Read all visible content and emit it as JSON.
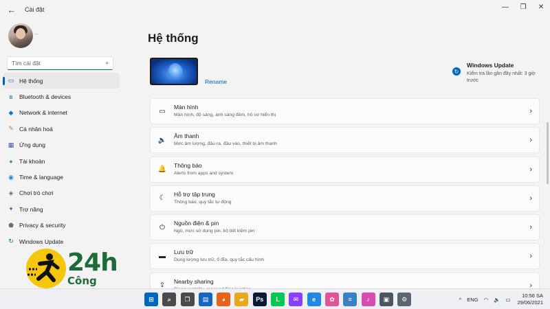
{
  "window": {
    "title": "Cài đặt",
    "controls": {
      "minimize": "—",
      "maximize": "❐",
      "close": "✕"
    }
  },
  "search": {
    "placeholder": "Tìm cài đặt"
  },
  "sidebar": {
    "items": [
      {
        "label": "Hệ thống",
        "icon": "system-icon",
        "glyph": "▭",
        "color": "#0067c0",
        "active": true
      },
      {
        "label": "Bluetooth & devices",
        "icon": "bluetooth-icon",
        "glyph": "ʙ",
        "color": "#0067c0"
      },
      {
        "label": "Network & internet",
        "icon": "network-icon",
        "glyph": "◆",
        "color": "#0078d4"
      },
      {
        "label": "Cá nhân hoá",
        "icon": "brush-icon",
        "glyph": "✎",
        "color": "#e07b2c"
      },
      {
        "label": "Ứng dụng",
        "icon": "apps-icon",
        "glyph": "▦",
        "color": "#3c5a99"
      },
      {
        "label": "Tài khoản",
        "icon": "account-icon",
        "glyph": "●",
        "color": "#2aa876"
      },
      {
        "label": "Time & language",
        "icon": "globe-icon",
        "glyph": "◉",
        "color": "#1a88d8"
      },
      {
        "label": "Chơi trò chơi",
        "icon": "gaming-icon",
        "glyph": "◈",
        "color": "#6b6b6b"
      },
      {
        "label": "Trợ năng",
        "icon": "accessibility-icon",
        "glyph": "✦",
        "color": "#1a6fd1"
      },
      {
        "label": "Privacy & security",
        "icon": "shield-icon",
        "glyph": "⬟",
        "color": "#6e6e6e"
      },
      {
        "label": "Windows Update",
        "icon": "update-icon",
        "glyph": "↻",
        "color": "#0067c0"
      }
    ]
  },
  "main": {
    "page_title": "Hệ thống",
    "rename": "Rename",
    "windows_update": {
      "title": "Windows Update",
      "subtitle": "Kiểm tra lần gần đây nhất: 3 giờ trước"
    },
    "cards": [
      {
        "title": "Màn hình",
        "desc": "Màn hình, độ sáng, ánh sáng đêm, hồ sơ hiển thị",
        "icon": "display-icon",
        "glyph": "▭"
      },
      {
        "title": "Âm thanh",
        "desc": "Mức âm lượng, đầu ra, đầu vào, thiết bị âm thanh",
        "icon": "speaker-icon",
        "glyph": "🔈"
      },
      {
        "title": "Thông báo",
        "desc": "Alerts from apps and system",
        "icon": "bell-icon",
        "glyph": "🔔"
      },
      {
        "title": "Hỗ trợ tập trung",
        "desc": "Thông báo, quy tắc tự động",
        "icon": "moon-icon",
        "glyph": "☾"
      },
      {
        "title": "Nguồn điện & pin",
        "desc": "Ngủ, mức sử dụng pin, bộ tiết kiệm pin",
        "icon": "power-icon",
        "glyph": "⏻"
      },
      {
        "title": "Lưu trữ",
        "desc": "Dung lượng lưu trữ, ổ đĩa, quy tắc cấu hình",
        "icon": "storage-icon",
        "glyph": "▬"
      },
      {
        "title": "Nearby sharing",
        "desc": "Discoverability, received files location",
        "icon": "share-icon",
        "glyph": "⇪"
      }
    ],
    "chevron": "›"
  },
  "watermark": {
    "brand": "24h",
    "tagline": "Công nghệ"
  },
  "taskbar": {
    "icons": [
      {
        "name": "start-icon",
        "glyph": "⊞",
        "bg": "#0067c0"
      },
      {
        "name": "search-icon",
        "glyph": "⌕",
        "bg": "#4a4a4a"
      },
      {
        "name": "taskview-icon",
        "glyph": "❐",
        "bg": "#4a4a4a"
      },
      {
        "name": "widgets-icon",
        "glyph": "▤",
        "bg": "#1565c0"
      },
      {
        "name": "firefox-icon",
        "glyph": "◕",
        "bg": "#e8631a"
      },
      {
        "name": "explorer-icon",
        "glyph": "▰",
        "bg": "#e7a91b"
      },
      {
        "name": "photoshop-icon",
        "glyph": "Ps",
        "bg": "#0b1a33"
      },
      {
        "name": "line-icon",
        "glyph": "L",
        "bg": "#06c755"
      },
      {
        "name": "messenger-icon",
        "glyph": "✉",
        "bg": "#8a3ffc"
      },
      {
        "name": "edge-icon",
        "glyph": "e",
        "bg": "#1e88e5"
      },
      {
        "name": "paint-icon",
        "glyph": "✿",
        "bg": "#e05599"
      },
      {
        "name": "notepad-icon",
        "glyph": "≡",
        "bg": "#3b82c4"
      },
      {
        "name": "itunes-icon",
        "glyph": "♪",
        "bg": "#d64cb0"
      },
      {
        "name": "store-icon",
        "glyph": "▣",
        "bg": "#4b5563"
      },
      {
        "name": "settings-icon",
        "glyph": "⚙",
        "bg": "#5b6470"
      }
    ],
    "tray": {
      "chevron": "^",
      "lang": "ENG",
      "time": "10:56 SA",
      "date": "29/06/2021"
    }
  }
}
